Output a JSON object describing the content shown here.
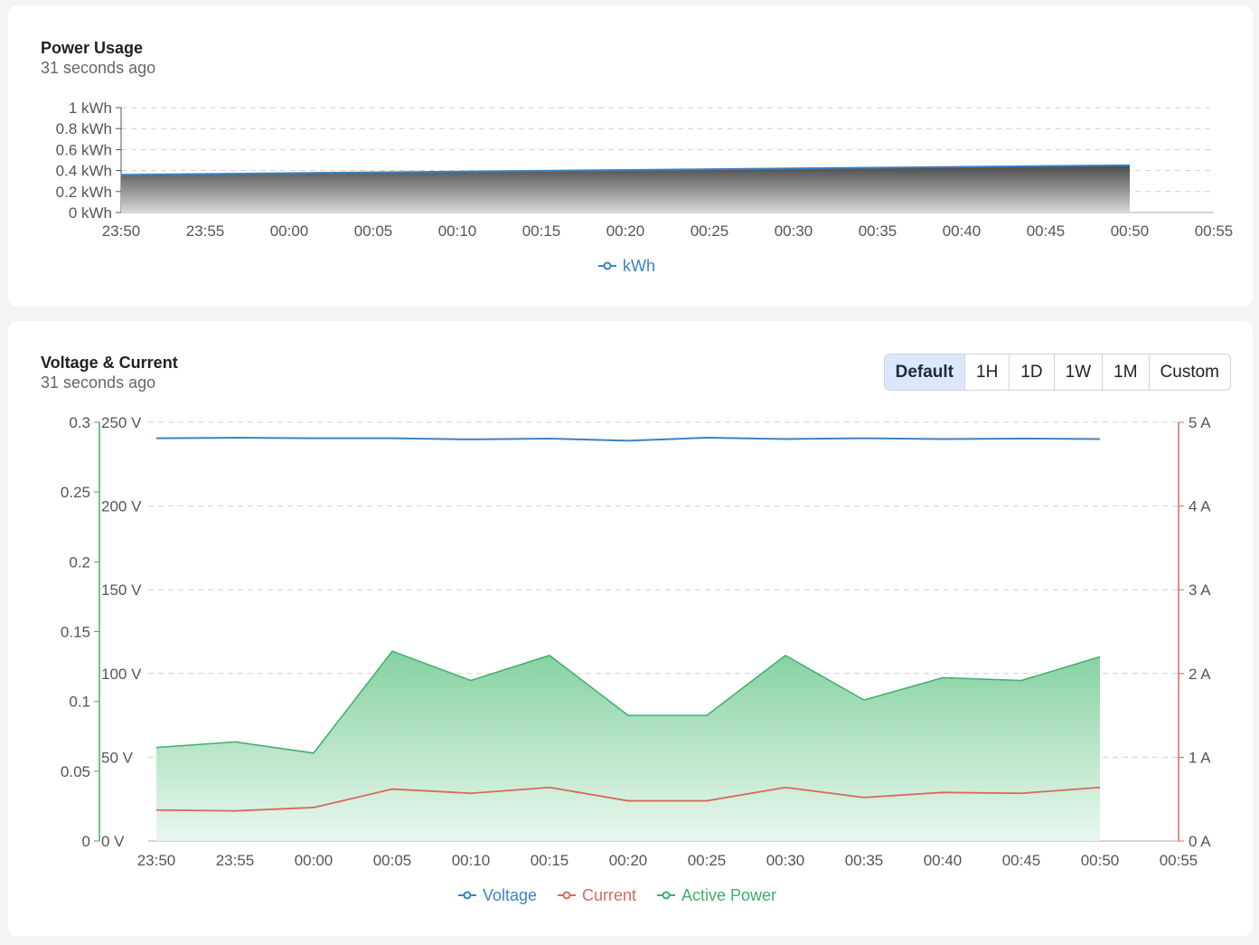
{
  "cards": [
    {
      "title": "Power Usage",
      "subtitle": "31 seconds ago"
    },
    {
      "title": "Voltage & Current",
      "subtitle": "31 seconds ago",
      "range_buttons": [
        "Default",
        "1H",
        "1D",
        "1W",
        "1M",
        "Custom"
      ],
      "active_range": "Default"
    }
  ],
  "colors": {
    "kwh": "#3b82c4",
    "voltage": "#3b82c4",
    "current": "#d9695f",
    "active_power": "#3fae6b"
  },
  "chart_data": [
    {
      "type": "area",
      "title": "Power Usage",
      "x_ticks": [
        "23:50",
        "23:55",
        "00:00",
        "00:05",
        "00:10",
        "00:15",
        "00:20",
        "00:25",
        "00:30",
        "00:35",
        "00:40",
        "00:45",
        "00:50",
        "00:55"
      ],
      "y_ticks": [
        "0 kWh",
        "0.2 kWh",
        "0.4 kWh",
        "0.6 kWh",
        "0.8 kWh",
        "1 kWh"
      ],
      "ylim": [
        0,
        1
      ],
      "grid": true,
      "legend": "bottom-center",
      "x": [
        "23:50",
        "00:50"
      ],
      "series": [
        {
          "name": "kWh",
          "values": [
            0.36,
            0.45
          ]
        }
      ]
    },
    {
      "type": "line",
      "title": "Voltage & Current",
      "x_ticks": [
        "23:50",
        "23:55",
        "00:00",
        "00:05",
        "00:10",
        "00:15",
        "00:20",
        "00:25",
        "00:30",
        "00:35",
        "00:40",
        "00:45",
        "00:50",
        "00:55"
      ],
      "x": [
        "23:50",
        "23:55",
        "00:00",
        "00:05",
        "00:10",
        "00:15",
        "00:20",
        "00:25",
        "00:30",
        "00:35",
        "00:40",
        "00:45",
        "00:50"
      ],
      "y_left_outer_ticks": [
        "0",
        "0.05",
        "0.1",
        "0.15",
        "0.2",
        "0.25",
        "0.3"
      ],
      "y_left_outer_lim": [
        0,
        0.3
      ],
      "y_left_inner_ticks": [
        "0 V",
        "50 V",
        "100 V",
        "150 V",
        "200 V",
        "250 V"
      ],
      "y_left_inner_lim": [
        0,
        250
      ],
      "y_right_ticks": [
        "0 A",
        "1 A",
        "2 A",
        "3 A",
        "4 A",
        "5 A"
      ],
      "y_right_lim": [
        0,
        5
      ],
      "grid": true,
      "legend": "bottom-center",
      "series": [
        {
          "name": "Voltage",
          "axis": "volts",
          "values": [
            240.5,
            240.8,
            240.5,
            240.5,
            239.8,
            240.3,
            239.0,
            240.8,
            240.0,
            240.5,
            240.0,
            240.3,
            240.0
          ]
        },
        {
          "name": "Current",
          "axis": "amps",
          "values": [
            0.37,
            0.36,
            0.4,
            0.62,
            0.57,
            0.64,
            0.48,
            0.48,
            0.64,
            0.52,
            0.58,
            0.57,
            0.64
          ]
        },
        {
          "name": "Active Power",
          "axis": "outer",
          "values": [
            0.067,
            0.071,
            0.063,
            0.136,
            0.115,
            0.133,
            0.09,
            0.09,
            0.133,
            0.101,
            0.117,
            0.115,
            0.132
          ]
        }
      ]
    }
  ]
}
